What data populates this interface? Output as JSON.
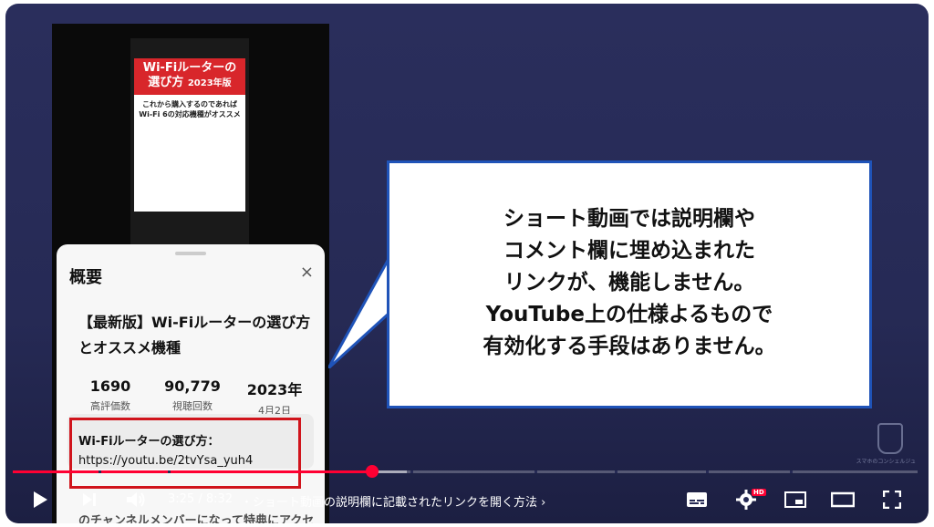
{
  "short_thumbnail": {
    "title_line1": "Wi-Fiルーターの",
    "title_line2": "選び方",
    "title_year": "2023年版",
    "body_line1": "これから購入するのであれば",
    "body_line2": "Wi-Fi 6の対応機種がオススメ"
  },
  "description_sheet": {
    "heading": "概要",
    "close_label": "×",
    "video_title": "【最新版】Wi-Fiルーターの選び方とオススメ機種",
    "stats": [
      {
        "value": "1690",
        "label": "高評価数"
      },
      {
        "value": "90,779",
        "label": "視聴回数"
      },
      {
        "value": "2023年",
        "label": "4月2日"
      }
    ],
    "link_text": "Wi-Fiルーターの選び方：",
    "link_url": "https://youtu.be/2tvYsa_yuh4",
    "next_text": "のチャンネルメンバーになって特典にアクセスしてください"
  },
  "callout": {
    "lines": [
      "ショート動画では説明欄や",
      "コメント欄に埋め込まれた",
      "リンクが、機能しません。",
      "YouTube上の仕様よるもので",
      "有効化する手段はありません。"
    ]
  },
  "watermark": {
    "text": "スマホのコンシェルジュ"
  },
  "player": {
    "progress_fraction": 0.397,
    "buffer_fraction": 0.435,
    "time": "3:25 / 8:32",
    "chapter": "・ショート動画の説明欄に記載されたリンクを開く方法",
    "chapter_chevron": "›",
    "hd_badge": "HD",
    "accent": "#ff0033"
  },
  "icons": [
    "play-icon",
    "next-icon",
    "volume-icon",
    "subtitles-icon",
    "settings-icon",
    "miniplayer-icon",
    "theater-icon",
    "fullscreen-icon"
  ]
}
